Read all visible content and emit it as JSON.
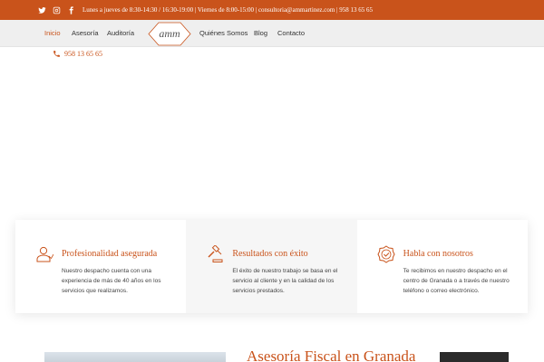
{
  "topbar": {
    "social": [
      "twitter-icon",
      "instagram-icon",
      "facebook-icon"
    ],
    "info": "Lunes a jueves de 8:30-14:30 / 16:30-19:00 | Viernes de 8:00-15:00 | consultoria@ammartinez.com | 958 13 65 65"
  },
  "nav": {
    "left": [
      "Inicio",
      "Asesoría",
      "Auditoría"
    ],
    "logo": "amm",
    "right": [
      "Quiénes Somos",
      "Blog",
      "Contacto"
    ]
  },
  "phone": "958 13 65 65",
  "features": [
    {
      "icon": "person-icon",
      "title": "Profesionalidad asegurada",
      "text": "Nuestro despacho cuenta con una experiencia de más de 40 años en los servicios que realizamos."
    },
    {
      "icon": "gavel-icon",
      "title": "Resultados con éxito",
      "text": "El éxito de nuestro trabajo se basa en el servicio al cliente y en la calidad de los servicios prestados."
    },
    {
      "icon": "badge-check-icon",
      "title": "Habla con nosotros",
      "text": "Te recibimos en nuestro despacho en el centro de Granada o a través de nuestro teléfono o correo electrónico."
    }
  ],
  "bottom": {
    "title": "Asesoría Fiscal en Granada"
  },
  "colors": {
    "accent": "#c9531b",
    "nav_bg": "#efefef",
    "text": "#333333"
  }
}
